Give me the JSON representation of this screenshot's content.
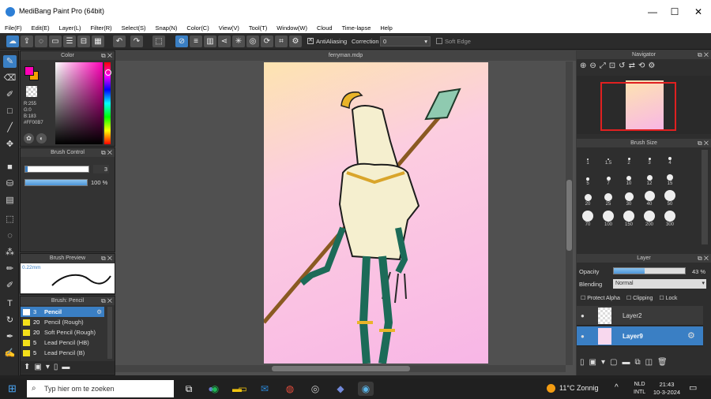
{
  "window": {
    "title": "MediBang Paint Pro (64bit)",
    "min": "—",
    "max": "☐",
    "close": "✕"
  },
  "menu": [
    "File(F)",
    "Edit(E)",
    "Layer(L)",
    "Filter(R)",
    "Select(S)",
    "Snap(N)",
    "Color(C)",
    "View(V)",
    "Tool(T)",
    "Window(W)",
    "Cloud",
    "Time-lapse",
    "Help"
  ],
  "toolbar": {
    "antialias_label": "AntiAliasing",
    "correction_label": "Correction",
    "correction_value": "0",
    "soft_edge_label": "Soft Edge"
  },
  "color_panel": {
    "title": "Color",
    "r": "R:255",
    "g": "G:0",
    "b": "B:183",
    "hex": "#FF00B7",
    "primary": "#ff00b7"
  },
  "brush_control": {
    "title": "Brush Control",
    "size": "3",
    "opacity": "100 %",
    "size_fill": 0.85,
    "opacity_fill": 1.0
  },
  "brush_preview": {
    "title": "Brush Preview",
    "size": "0.22mm"
  },
  "brush_list": {
    "title": "Brush: Pencil",
    "items": [
      {
        "num": "3",
        "name": "Pencil",
        "color": "#3a7fc4",
        "selected": true
      },
      {
        "num": "20",
        "name": "Pencil (Rough)",
        "color": "#f4e01a",
        "selected": false
      },
      {
        "num": "20",
        "name": "Soft Pencil (Rough)",
        "color": "#f4e01a",
        "selected": false
      },
      {
        "num": "5",
        "name": "Lead Pencil (HB)",
        "color": "#f4e01a",
        "selected": false
      },
      {
        "num": "5",
        "name": "Lead Pencil (B)",
        "color": "#f4e01a",
        "selected": false
      }
    ]
  },
  "document": {
    "tab": "ferryman.mdp"
  },
  "navigator": {
    "title": "Navigator"
  },
  "brush_size": {
    "title": "Brush Size",
    "sizes": [
      "1",
      "1.5",
      "2",
      "3",
      "4",
      "5",
      "7",
      "10",
      "12",
      "15",
      "20",
      "25",
      "30",
      "40",
      "50",
      "70",
      "100",
      "150",
      "200",
      "300"
    ]
  },
  "layer_panel": {
    "title": "Layer",
    "opacity_label": "Opacity",
    "opacity_value": "43 %",
    "opacity_fill": 0.43,
    "blending_label": "Blending",
    "blending_value": "Normal",
    "protect_alpha": "Protect Alpha",
    "clipping": "Clipping",
    "lock": "Lock",
    "layers": [
      {
        "name": "Layer2",
        "selected": false
      },
      {
        "name": "Layer9",
        "selected": true
      }
    ]
  },
  "taskbar": {
    "search_placeholder": "Typ hier om te zoeken",
    "weather": "11°C  Zonnig",
    "lang1": "NLD",
    "lang2": "INTL",
    "time": "21:43",
    "date": "10-3-2024"
  }
}
